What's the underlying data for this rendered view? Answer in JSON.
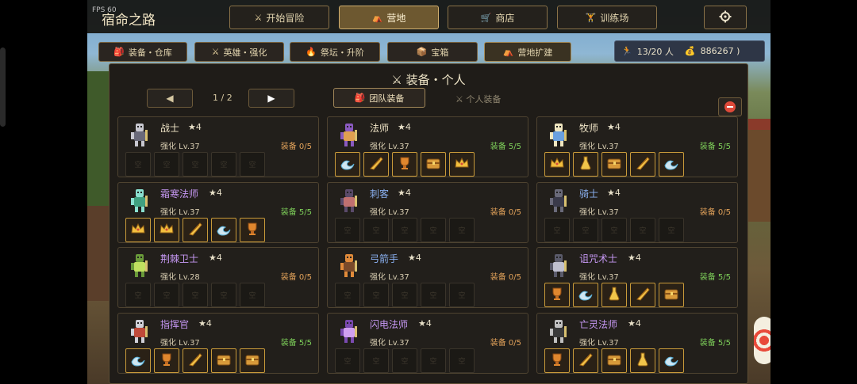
{
  "fps": "FPS 60",
  "game_title": "宿命之路",
  "nav": [
    {
      "label": "开始冒险",
      "icon": "crossed-swords-icon",
      "glyph": "⚔",
      "active": false
    },
    {
      "label": "营地",
      "icon": "campfire-icon",
      "glyph": "⛺",
      "active": true
    },
    {
      "label": "商店",
      "icon": "cart-icon",
      "glyph": "🛒",
      "active": false
    },
    {
      "label": "训练场",
      "icon": "dumbbell-icon",
      "glyph": "🏋",
      "active": false
    }
  ],
  "settings_icon": "gear-icon",
  "subtabs": [
    {
      "label": "装备・仓库",
      "icon": "bag-icon",
      "glyph": "🎒"
    },
    {
      "label": "英雄・强化",
      "icon": "crossed-swords-icon",
      "glyph": "⚔"
    },
    {
      "label": "祭坛・升阶",
      "icon": "flame-icon",
      "glyph": "🔥"
    },
    {
      "label": "宝箱",
      "icon": "chest-icon",
      "glyph": "📦"
    },
    {
      "label": "营地扩建",
      "icon": "campfire-icon",
      "glyph": "⛺"
    }
  ],
  "resources": {
    "population": "13/20 人",
    "gold": "886267 )"
  },
  "panel": {
    "title": "⚔ 装备・个人",
    "page": "1 / 2",
    "prev": "◀",
    "next": "▶",
    "team_label": "团队装备",
    "personal_label": "⚔ 个人装备"
  },
  "colors": {
    "name_normal": "#efe4c6",
    "name_rare": "#8ab0f0",
    "name_epic": "#c597f2",
    "equip_full": "#7ed05a",
    "equip_empty": "#e2a25a"
  },
  "empty_slot": "空",
  "heroes": [
    {
      "name": "战士",
      "rarity": "normal",
      "stars": "★4",
      "level": "强化 Lv.37",
      "equip": "装备 0/5",
      "full": false,
      "items": []
    },
    {
      "name": "法师",
      "rarity": "normal",
      "stars": "★4",
      "level": "强化 Lv.37",
      "equip": "装备 5/5",
      "full": true,
      "items": [
        "wave",
        "feather",
        "trophy",
        "chest",
        "crown"
      ]
    },
    {
      "name": "牧师",
      "rarity": "normal",
      "stars": "★4",
      "level": "强化 Lv.37",
      "equip": "装备 5/5",
      "full": true,
      "items": [
        "crown",
        "flask",
        "chest",
        "feather",
        "wave"
      ]
    },
    {
      "name": "霜寒法师",
      "rarity": "epic",
      "stars": "★4",
      "level": "强化 Lv.37",
      "equip": "装备 5/5",
      "full": true,
      "items": [
        "crown",
        "crown",
        "feather",
        "wave",
        "trophy"
      ]
    },
    {
      "name": "刺客",
      "rarity": "rare",
      "stars": "★4",
      "level": "强化 Lv.37",
      "equip": "装备 0/5",
      "full": false,
      "items": []
    },
    {
      "name": "骑士",
      "rarity": "rare",
      "stars": "★4",
      "level": "强化 Lv.37",
      "equip": "装备 0/5",
      "full": false,
      "items": []
    },
    {
      "name": "荆棘卫士",
      "rarity": "epic",
      "stars": "★4",
      "level": "强化 Lv.28",
      "equip": "装备 0/5",
      "full": false,
      "items": []
    },
    {
      "name": "弓箭手",
      "rarity": "rare",
      "stars": "★4",
      "level": "强化 Lv.37",
      "equip": "装备 0/5",
      "full": false,
      "items": []
    },
    {
      "name": "诅咒术士",
      "rarity": "epic",
      "stars": "★4",
      "level": "强化 Lv.37",
      "equip": "装备 5/5",
      "full": true,
      "items": [
        "trophy",
        "wave",
        "flask",
        "feather",
        "chest"
      ]
    },
    {
      "name": "指挥官",
      "rarity": "epic",
      "stars": "★4",
      "level": "强化 Lv.37",
      "equip": "装备 5/5",
      "full": true,
      "items": [
        "wave",
        "trophy",
        "feather",
        "chest",
        "chest"
      ]
    },
    {
      "name": "闪电法师",
      "rarity": "epic",
      "stars": "★4",
      "level": "强化 Lv.37",
      "equip": "装备 0/5",
      "full": false,
      "items": []
    },
    {
      "name": "亡灵法师",
      "rarity": "epic",
      "stars": "★4",
      "level": "强化 Lv.37",
      "equip": "装备 5/5",
      "full": true,
      "items": [
        "trophy",
        "feather",
        "chest",
        "flask",
        "wave"
      ]
    }
  ]
}
